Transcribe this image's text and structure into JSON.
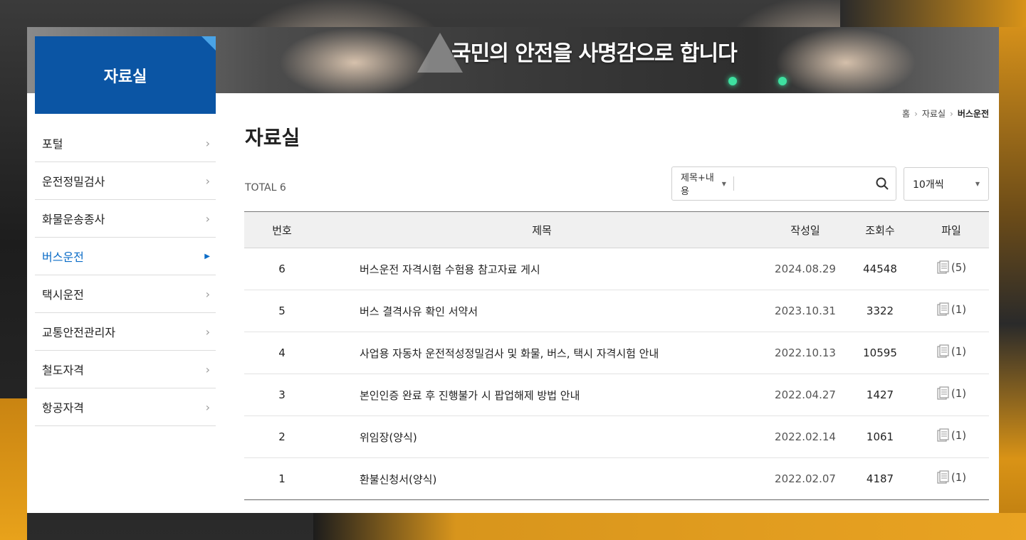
{
  "banner": {
    "slogan": "국민의 안전을 사명감으로 합니다"
  },
  "sidebar": {
    "title": "자료실",
    "items": [
      {
        "label": "포털",
        "active": false
      },
      {
        "label": "운전정밀검사",
        "active": false
      },
      {
        "label": "화물운송종사",
        "active": false
      },
      {
        "label": "버스운전",
        "active": true
      },
      {
        "label": "택시운전",
        "active": false
      },
      {
        "label": "교통안전관리자",
        "active": false
      },
      {
        "label": "철도자격",
        "active": false
      },
      {
        "label": "항공자격",
        "active": false
      }
    ]
  },
  "breadcrumb": {
    "home": "홈",
    "level1": "자료실",
    "current": "버스운전"
  },
  "page": {
    "title": "자료실",
    "total": "TOTAL 6"
  },
  "search": {
    "field_select": "제목+내용",
    "placeholder": "",
    "value": "",
    "icon": "search-icon"
  },
  "page_size": {
    "selected": "10개씩"
  },
  "table": {
    "headers": {
      "no": "번호",
      "title": "제목",
      "date": "작성일",
      "views": "조회수",
      "file": "파일"
    },
    "rows": [
      {
        "no": "6",
        "title": "버스운전 자격시험 수험용 참고자료 게시",
        "date": "2024.08.29",
        "views": "44548",
        "files": "(5)"
      },
      {
        "no": "5",
        "title": "버스 결격사유 확인 서약서",
        "date": "2023.10.31",
        "views": "3322",
        "files": "(1)"
      },
      {
        "no": "4",
        "title": "사업용 자동차 운전적성정밀검사 및 화물, 버스, 택시 자격시험 안내",
        "date": "2022.10.13",
        "views": "10595",
        "files": "(1)"
      },
      {
        "no": "3",
        "title": "본인인증 완료 후 진행불가 시 팝업해제 방법 안내",
        "date": "2022.04.27",
        "views": "1427",
        "files": "(1)"
      },
      {
        "no": "2",
        "title": "위임장(양식)",
        "date": "2022.02.14",
        "views": "1061",
        "files": "(1)"
      },
      {
        "no": "1",
        "title": "환불신청서(양식)",
        "date": "2022.02.07",
        "views": "4187",
        "files": "(1)"
      }
    ]
  },
  "colors": {
    "primary": "#0b55a4",
    "active_link": "#0b6cc7"
  }
}
